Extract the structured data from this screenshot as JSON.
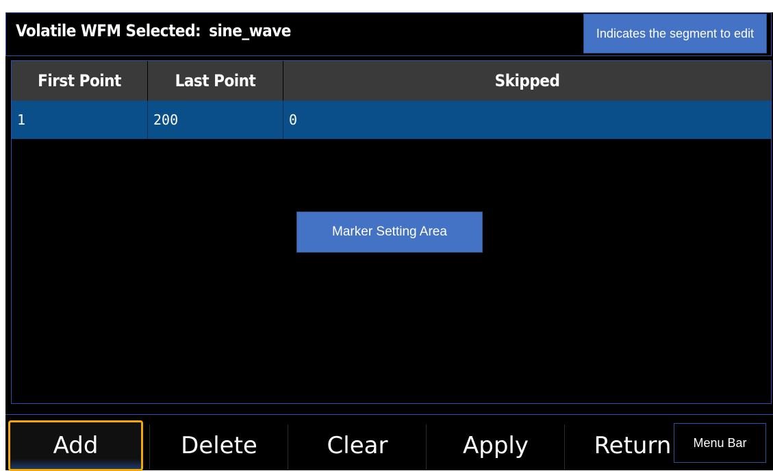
{
  "header": {
    "label": "Volatile WFM Selected:",
    "value": "sine_wave"
  },
  "callouts": {
    "segment": "Indicates the segment to edit",
    "marker": "Marker Setting Area",
    "menu_bar": "Menu Bar"
  },
  "table": {
    "columns": [
      "First Point",
      "Last Point",
      "Skipped"
    ],
    "rows": [
      [
        "1",
        "200",
        "0"
      ]
    ]
  },
  "menu": {
    "add": "Add",
    "delete": "Delete",
    "clear": "Clear",
    "apply": "Apply",
    "return": "Return"
  },
  "colors": {
    "selected_row": "#0a4f8a",
    "focus_border": "#f5a800",
    "callout": "#4472c4"
  }
}
